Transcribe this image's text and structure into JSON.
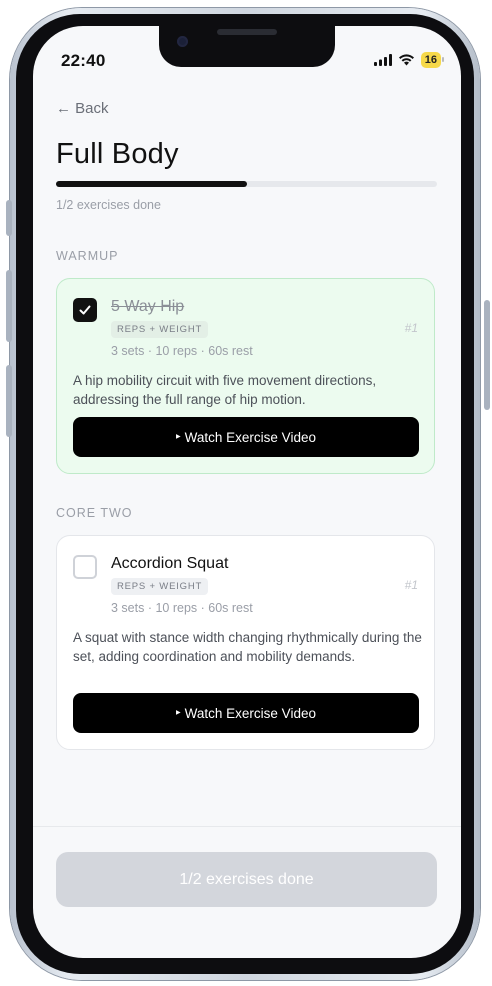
{
  "status": {
    "time": "22:40",
    "battery": "16"
  },
  "nav": {
    "back_label": "← Back"
  },
  "workout": {
    "title": "Full Body",
    "progress_fraction": 0.5,
    "progress_text": "1/2 exercises done"
  },
  "sections": [
    {
      "label": "WARMUP",
      "exercise": {
        "name": "5 Way Hip",
        "completed": true,
        "tag": "REPS + WEIGHT",
        "meta": "3 sets · 10 reps · 60s rest",
        "number": "#1",
        "description": "A hip mobility circuit with five movement directions, addressing the full range of hip motion.",
        "video_button": "Watch Exercise Video"
      }
    },
    {
      "label": "CORE TWO",
      "exercise": {
        "name": "Accordion Squat",
        "completed": false,
        "tag": "REPS + WEIGHT",
        "meta": "3 sets · 10 reps · 60s rest",
        "number": "#1",
        "description": "A squat with stance width changing rhythmically during the set, adding coordination and mobility demands.",
        "video_button": "Watch Exercise Video"
      }
    }
  ],
  "footer": {
    "button_label": "1/2 exercises done"
  },
  "icons": {
    "back": "arrow-left-icon",
    "check": "check-icon",
    "play": "play-icon",
    "signal": "signal-icon",
    "wifi": "wifi-icon",
    "battery": "battery-icon"
  },
  "colors": {
    "accent": "#000000",
    "done_card_bg": "#ecfbef",
    "done_card_border": "#bfeac9",
    "disabled_button": "#d3d6dc"
  }
}
